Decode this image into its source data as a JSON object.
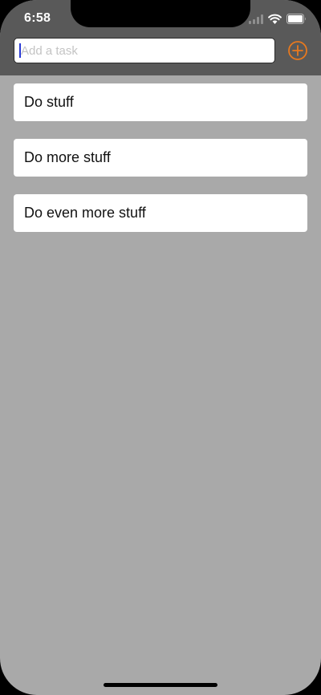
{
  "status_bar": {
    "time": "6:58",
    "icons": [
      "cellular-signal-icon",
      "wifi-icon",
      "battery-icon"
    ]
  },
  "task_input": {
    "value": "",
    "placeholder": "Add a task"
  },
  "add_button": {
    "icon": "plus-circle-icon"
  },
  "tasks": [
    {
      "label": "Do stuff"
    },
    {
      "label": "Do more stuff"
    },
    {
      "label": "Do even more stuff"
    }
  ],
  "colors": {
    "header_background": "#595959",
    "page_background": "#a9a9a9",
    "accent": "#e8791e",
    "card_background": "#ffffff"
  }
}
